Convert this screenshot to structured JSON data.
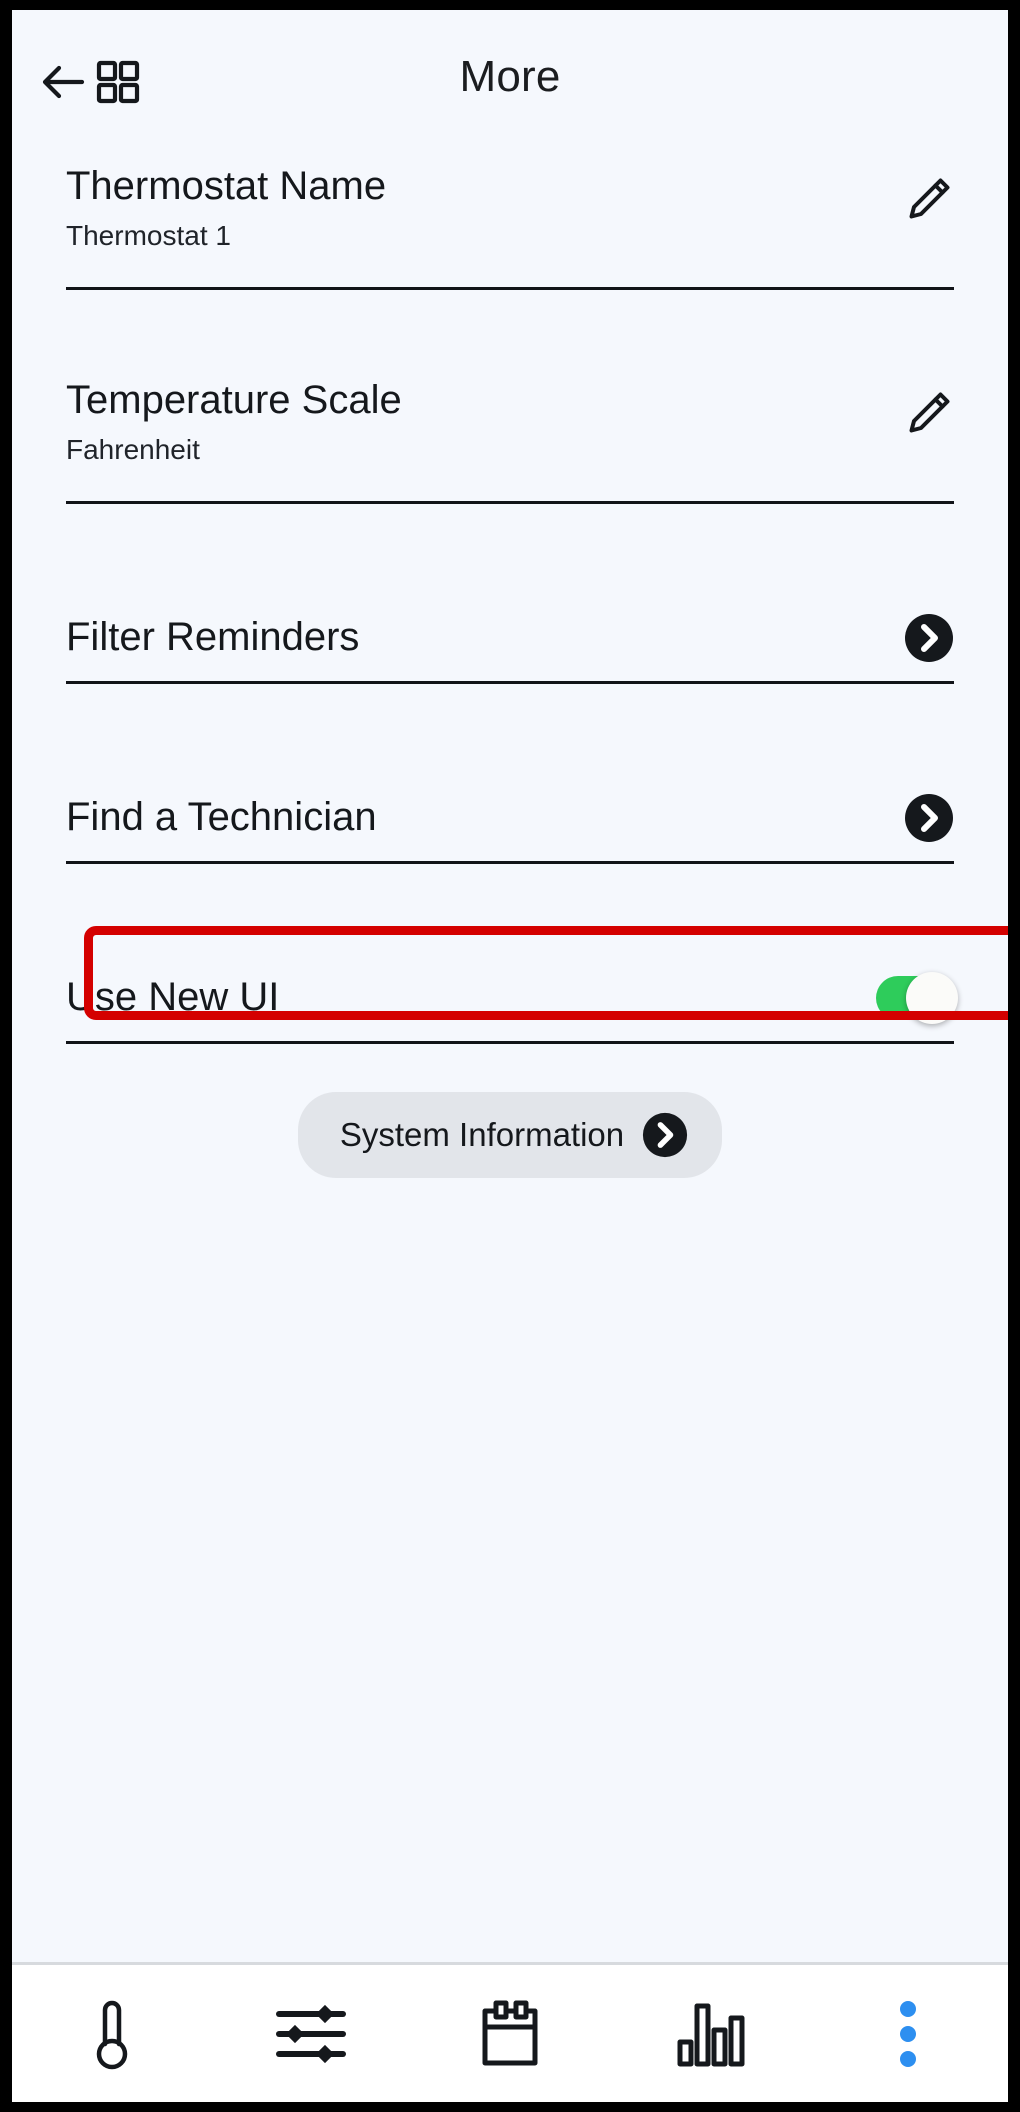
{
  "header": {
    "title": "More",
    "back_icon": "back-arrow-icon",
    "grid_icon": "grid-icon"
  },
  "settings": {
    "rows": [
      {
        "title": "Thermostat Name",
        "value": "Thermostat 1",
        "action": "edit-pencil-icon"
      },
      {
        "title": "Temperature Scale",
        "value": "Fahrenheit",
        "action": "edit-pencil-icon"
      },
      {
        "title": "Filter Reminders",
        "action": "chevron-right-circle-icon"
      },
      {
        "title": "Find a Technician",
        "action": "chevron-right-circle-icon"
      },
      {
        "title": "Use New UI",
        "action": "toggle-switch",
        "toggle_on": true,
        "highlighted": true
      }
    ]
  },
  "system_information": {
    "label": "System Information",
    "icon": "chevron-right-circle-icon"
  },
  "bottom_nav": {
    "items": [
      {
        "icon": "thermometer-icon",
        "name": "nav-thermostat"
      },
      {
        "icon": "sliders-icon",
        "name": "nav-settings"
      },
      {
        "icon": "calendar-icon",
        "name": "nav-schedule"
      },
      {
        "icon": "bar-chart-icon",
        "name": "nav-usage"
      },
      {
        "icon": "more-vertical-dots-icon",
        "name": "nav-more"
      }
    ]
  },
  "colors": {
    "page_background": "#f5f8fd",
    "toggle_on": "#2ecc5b",
    "toggle_knob": "#fbfbf9",
    "highlight_border": "#d40000",
    "accent_dots": "#2d8ff0",
    "button_background": "#e2e5ea",
    "text_primary": "#15181c",
    "divider": "#111418",
    "device_frame": "#000000"
  }
}
